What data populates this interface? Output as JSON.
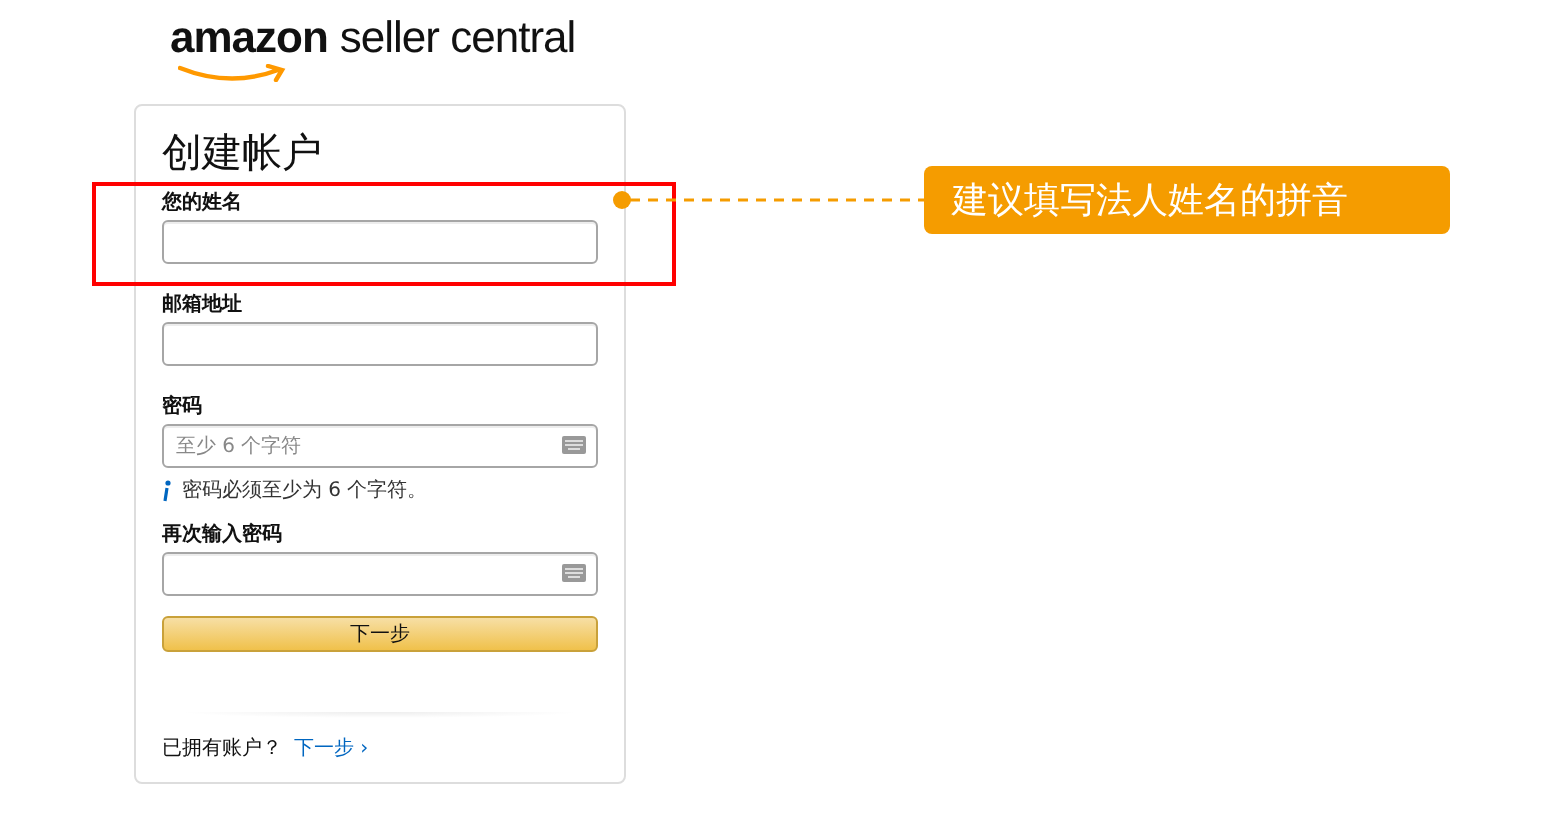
{
  "logo": {
    "wordmark": "amazon",
    "product": "seller central"
  },
  "form": {
    "title": "创建帐户",
    "fields": [
      {
        "label": "您的姓名",
        "keyboard": false
      },
      {
        "label": "邮箱地址",
        "keyboard": false
      },
      {
        "label": "密码",
        "placeholder": "至少 6 个字符",
        "keyboard": true,
        "hint": "密码必须至少为 6 个字符。"
      },
      {
        "label": "再次输入密码",
        "keyboard": true
      }
    ],
    "submit": "下一步",
    "signin_prompt": "已拥有账户？",
    "signin_link": "下一步 ›"
  },
  "annotation": {
    "text": "建议填写法人姓名的拼音"
  }
}
